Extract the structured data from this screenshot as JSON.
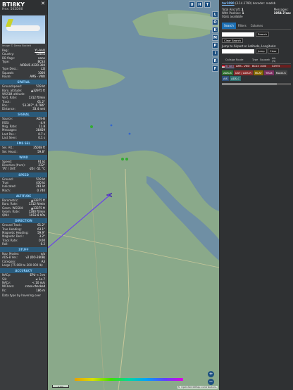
{
  "aircraft": {
    "callsign": "BTI8KY",
    "hex_label": "Hex: 502D00",
    "photo_credit": "Image © Demo Bockelt",
    "fields": [
      {
        "k": "Reg.:",
        "v": "YL-AAQ",
        "link": true
      },
      {
        "k": "Country:",
        "v": "Latvia"
      },
      {
        "k": "DB flags:",
        "v": "none"
      },
      {
        "k": "Type:",
        "v": "BCS3"
      },
      {
        "k": "",
        "v": "AIRBUS A220-300"
      },
      {
        "k": "Type Desc.:",
        "v": "L2J"
      },
      {
        "k": "Squawk:",
        "v": "1000"
      },
      {
        "k": "Route:",
        "v": "AMS - VNO"
      }
    ]
  },
  "sections": [
    {
      "title": "SPATIAL",
      "rows": [
        [
          "Groundspeed:",
          "519 kt"
        ],
        [
          "Baro. altitude:",
          "▲32975 ft"
        ],
        [
          "WGS84 altitude:",
          ""
        ],
        [
          "Vert. Rate:",
          "1312 ft/min"
        ],
        [
          "Track:",
          "61.2°"
        ],
        [
          "Pos.:",
          "53.397°, 6.786°"
        ],
        [
          "Distance:",
          "33.4 nmi"
        ]
      ]
    },
    {
      "title": "SIGNAL",
      "rows": [
        [
          "Source:",
          "ADS-B"
        ],
        [
          "RSSI:",
          "-4.9"
        ],
        [
          "Msg. Rate:",
          "11.8"
        ],
        [
          "Messages:",
          "28459"
        ],
        [
          "Last Pos.:",
          "0.7 s"
        ],
        [
          "Last Seen:",
          "0.1 s"
        ]
      ]
    },
    {
      "title": "FMS SEL",
      "rows": [
        [
          "Sel. Alt.:",
          "35008 ft"
        ],
        [
          "Sel. Head.:",
          "59.8°"
        ]
      ]
    },
    {
      "title": "WIND",
      "rows": [
        [
          "Speed:",
          "91 kt"
        ],
        [
          "Direction (from):",
          "232°"
        ],
        [
          "TAT / OAT:",
          "-26 / -51 °C"
        ]
      ]
    },
    {
      "title": "SPEED",
      "rows": [
        [
          "Ground:",
          "519 kt"
        ],
        [
          "True:",
          "430 kt"
        ],
        [
          "Indicated:",
          "261 kt"
        ],
        [
          "Mach:",
          "0.740"
        ]
      ]
    },
    {
      "title": "ALTITUDE",
      "rows": [
        [
          "Barometric:",
          "▲33375 ft"
        ],
        [
          "Baro. Rate:",
          "1312 ft/min"
        ],
        [
          "Geom. WGS84:",
          "▲33375 ft"
        ],
        [
          "Geom. Rate:",
          "1280 ft/min"
        ],
        [
          "QNH:",
          "1012.8 hPa"
        ]
      ]
    },
    {
      "title": "DIRECTION",
      "rows": [
        [
          "Ground Track:",
          "61.2°"
        ],
        [
          "True Heading:",
          "63.1°"
        ],
        [
          "Magnetic Heading:",
          "59.9°"
        ],
        [
          "Magnetic Decl.:",
          "3.2°"
        ],
        [
          "Track Rate:",
          "0.00"
        ],
        [
          "Roll:",
          "0.2"
        ]
      ]
    },
    {
      "title": "STUFF",
      "rows": [
        [
          "Nav. Modes:",
          "n/a"
        ],
        [
          "ADS-B Ver.:",
          "v2 (DO-260B)"
        ],
        [
          "Category:",
          "A3"
        ],
        [
          "Large (75 000 to 300 000 lb)",
          ""
        ]
      ]
    },
    {
      "title": "ACCURACY",
      "rows": [
        [
          "NACp:",
          "EPU < 3 m"
        ],
        [
          "SIL:",
          "≤ 1e-7"
        ],
        [
          "NACv:",
          "< 10 m/s"
        ],
        [
          "NICbaro:",
          "cross-checked"
        ],
        [
          "Rc:",
          "186 m"
        ]
      ]
    }
  ],
  "footer_note": "Data type by hovering over",
  "map": {
    "top_buttons": [
      "U",
      "H",
      "T"
    ],
    "side_buttons": [
      "L",
      "O",
      "K",
      "M",
      "P",
      "I",
      "R",
      "F"
    ],
    "zoom_in": "+",
    "zoom_out": "−",
    "attribution": "© OpenStreetMap contributors.",
    "scale": "5 km",
    "alt_labels": [
      "",
      "",
      "",
      "",
      "",
      "",
      ""
    ]
  },
  "right": {
    "link": "tar1090",
    "version": "(3.14.1790) decoder: readsb",
    "stats": {
      "total_label": "Total Aircraft:",
      "total": "1",
      "msg_label": "Messages:",
      "msg": "1954.7/sec",
      "pos_label": "With Position:",
      "pos": "1",
      "extra": "Stats available"
    },
    "tabs": [
      "Search",
      "Filters",
      "Columns"
    ],
    "search_btn": "Search",
    "clear_search": "Clear Search",
    "jump_label": "Jump to Airport or Latitude, Longitude:",
    "jump_btn": "Jump",
    "clear_btn": "Clear",
    "columns": [
      "",
      "Callsign",
      "Route",
      "Type",
      "Squawk",
      "Alt. (ft)"
    ],
    "row": {
      "callsign": "BTI8KY",
      "route": "AMS - VNO",
      "type": "BCS3",
      "squawk": "1000",
      "alt": "32975"
    },
    "tags": [
      {
        "t": "ADS-B",
        "c": "#2f6e2f"
      },
      {
        "t": "UAT / ADS-R",
        "c": "#8a2f2f"
      },
      {
        "t": "MLAT",
        "c": "#8a6a00"
      },
      {
        "t": "TIS-B",
        "c": "#7a2f5f"
      },
      {
        "t": "Mode-S",
        "c": "#444"
      },
      {
        "t": "AIS",
        "c": "#2f4f7a"
      },
      {
        "t": "ADS-C",
        "c": "#2f6e6e"
      }
    ]
  }
}
